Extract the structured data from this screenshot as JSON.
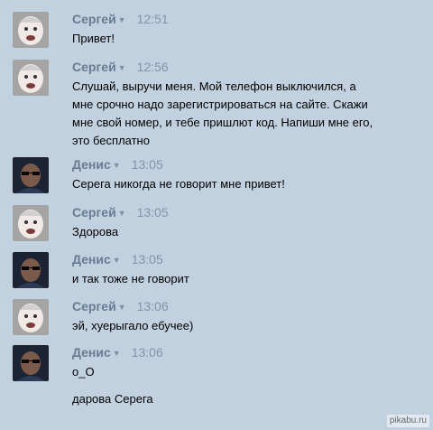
{
  "caret": "▼",
  "messages": [
    {
      "author": "Сергей",
      "avatar": "baby-avatar",
      "time": "12:51",
      "text": "Привет!"
    },
    {
      "author": "Сергей",
      "avatar": "baby-avatar",
      "time": "12:56",
      "text": "Слушай, выручи меня. Мой телефон выключился, а мне срочно надо зарегистрироваться на сайте. Скажи мне свой номер, и тебе пришлют код. Напиши мне его, это бесплатно"
    },
    {
      "author": "Денис",
      "avatar": "sunglasses-avatar",
      "time": "13:05",
      "text": "Серега никогда не говорит мне привет!"
    },
    {
      "author": "Сергей",
      "avatar": "baby-avatar",
      "time": "13:05",
      "text": "Здорова"
    },
    {
      "author": "Денис",
      "avatar": "sunglasses-avatar",
      "time": "13:05",
      "text": "и так тоже не говорит"
    },
    {
      "author": "Сергей",
      "avatar": "baby-avatar",
      "time": "13:06",
      "text": "эй, хуерыгало ебучее)"
    },
    {
      "author": "Денис",
      "avatar": "sunglasses-avatar",
      "time": "13:06",
      "text": "о_О",
      "extra": "дарова Серега"
    }
  ],
  "watermark": "pikabu.ru",
  "colors": {
    "background": "#c2d1df",
    "author_name": "#667b92",
    "timestamp": "#7f95ac"
  }
}
